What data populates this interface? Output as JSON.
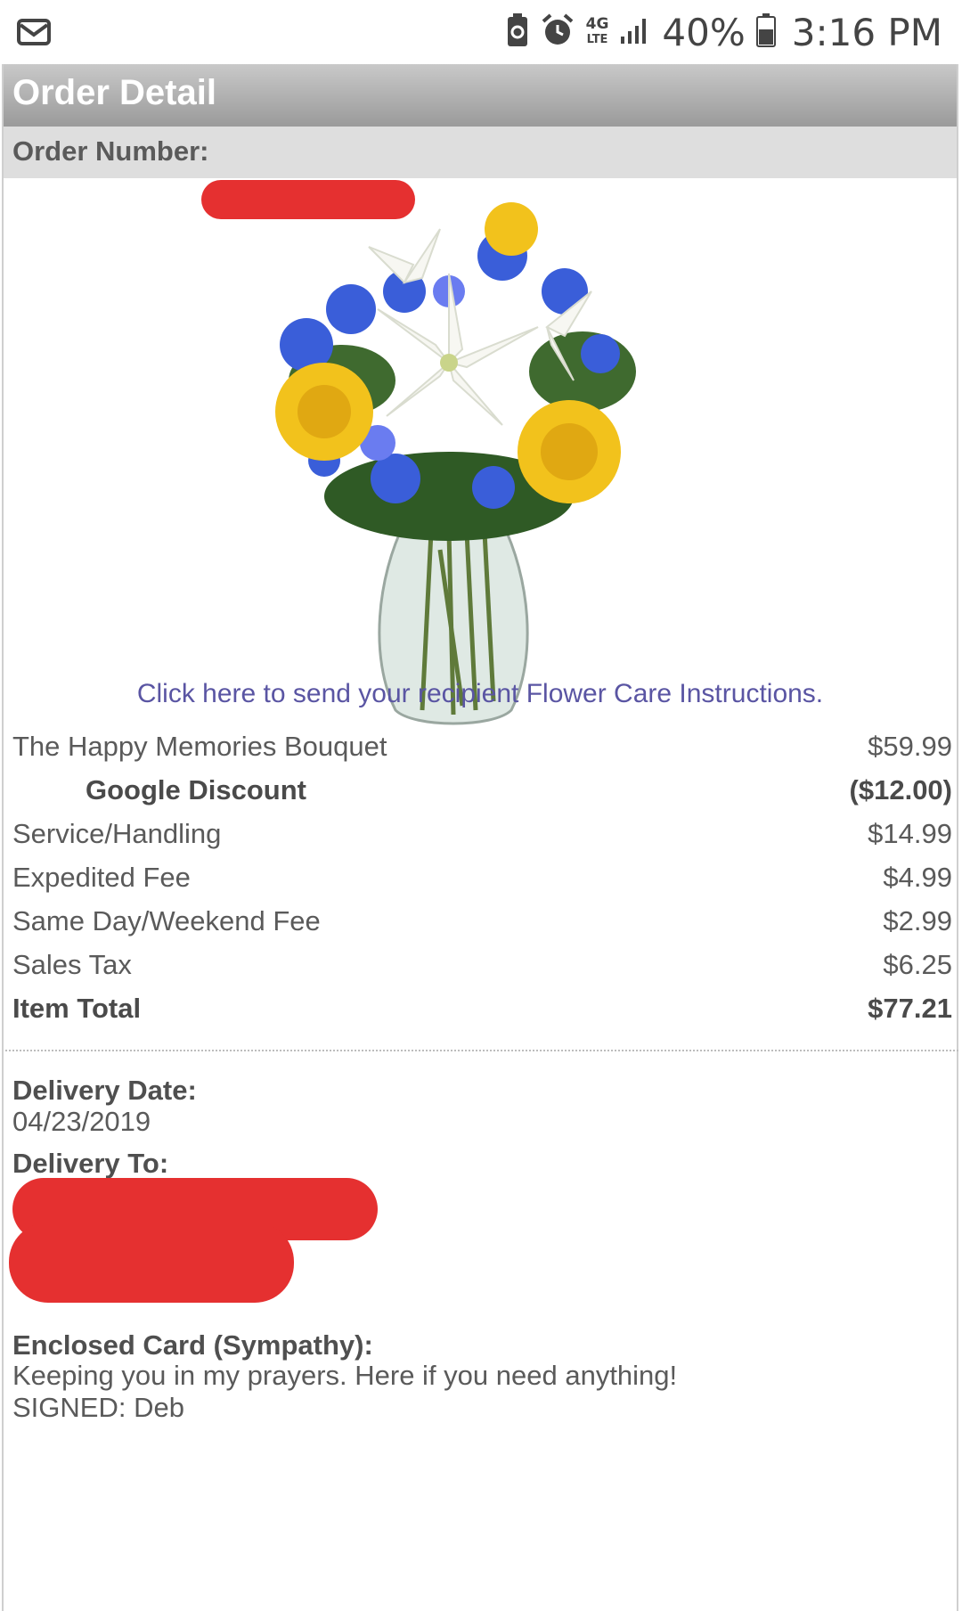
{
  "status_bar": {
    "battery_percent": "40%",
    "time": "3:16 PM",
    "network_label": "4G",
    "network_sub": "LTE",
    "icons": [
      "mail-icon",
      "battery-saver-icon",
      "alarm-icon",
      "lte-icon",
      "signal-icon",
      "battery-icon"
    ]
  },
  "header": {
    "title": "Order Detail",
    "order_number_label": "Order Number:"
  },
  "product_image": "bouquet of white lilies, yellow roses and blue flowers in a glass vase",
  "care_link": "Click here to send your recipient Flower Care Instructions.",
  "line_items": [
    {
      "name": "The Happy Memories Bouquet",
      "amount": "$59.99",
      "style": "normal"
    },
    {
      "name": "Google Discount",
      "amount": "($12.00)",
      "style": "discount"
    },
    {
      "name": "Service/Handling",
      "amount": "$14.99",
      "style": "normal"
    },
    {
      "name": "Expedited Fee",
      "amount": "$4.99",
      "style": "normal"
    },
    {
      "name": "Same Day/Weekend Fee",
      "amount": "$2.99",
      "style": "normal"
    },
    {
      "name": "Sales Tax",
      "amount": "$6.25",
      "style": "normal"
    },
    {
      "name": "Item Total",
      "amount": "$77.21",
      "style": "total"
    }
  ],
  "delivery": {
    "date_label": "Delivery Date:",
    "date_value": "04/23/2019",
    "to_label": "Delivery To:"
  },
  "card": {
    "label": "Enclosed Card (Sympathy):",
    "message": "Keeping you in my prayers. Here if you need anything!",
    "signed_partial": "SIGNED: Deb"
  },
  "colors": {
    "header_top": "#c9c9c9",
    "header_bottom": "#9a9a9a",
    "order_bar": "#dedede",
    "link": "#5a55a3",
    "redaction": "#e53030"
  }
}
